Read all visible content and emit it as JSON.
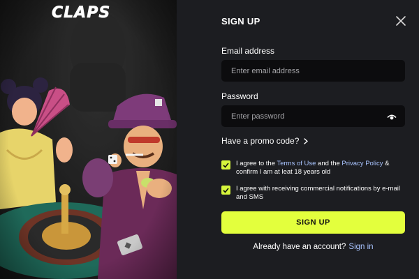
{
  "brand": {
    "logo_text": "CLAPS"
  },
  "signup": {
    "title": "SIGN UP",
    "email": {
      "label": "Email address",
      "placeholder": "Enter email address",
      "value": ""
    },
    "password": {
      "label": "Password",
      "placeholder": "Enter password",
      "value": ""
    },
    "promo": {
      "label": "Have a promo code?",
      "icon": "chevron-right-icon"
    },
    "terms": {
      "checked": true,
      "prefix": "I agree to the ",
      "terms_link": "Terms of Use",
      "middle": " and the ",
      "privacy_link": "Privacy Policy",
      "suffix": " & confirm I am at leat 18 years old"
    },
    "notifications": {
      "checked": true,
      "text": "I agree with receiving commercial notifications by e-mail and SMS"
    },
    "submit_label": "SIGN UP",
    "footer": {
      "prompt": "Already have an account?",
      "link": "Sign in"
    }
  },
  "icons": {
    "close": "close-icon",
    "eye": "eye-icon",
    "check": "check-icon"
  },
  "colors": {
    "background": "#1c1d21",
    "input_bg": "#0c0c0e",
    "accent": "#e3ff3d",
    "link": "#a9c4ff",
    "text": "#ffffff",
    "placeholder": "#a4a4a8"
  }
}
